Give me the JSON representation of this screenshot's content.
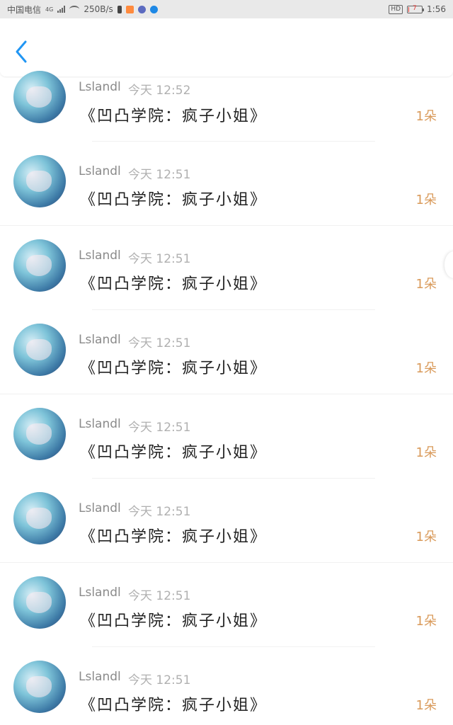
{
  "status_bar": {
    "carrier": "中国电信",
    "network_type": "4G",
    "net_speed": "250B/s",
    "hd_label": "HD",
    "battery_level": "7",
    "battery_percent": 0.07,
    "time": "1:56"
  },
  "header": {
    "back_icon": "chevron-left-icon",
    "accent_color": "#2196f3"
  },
  "colors": {
    "count_color": "#d99a5a",
    "name_color": "#8a8a8a"
  },
  "messages": [
    {
      "user": "Lslandl",
      "time": "今天 12:52",
      "title": "《凹凸学院：疯子小姐》",
      "count": "1朵"
    },
    {
      "user": "Lslandl",
      "time": "今天 12:51",
      "title": "《凹凸学院：疯子小姐》",
      "count": "1朵"
    },
    {
      "user": "Lslandl",
      "time": "今天 12:51",
      "title": "《凹凸学院：疯子小姐》",
      "count": "1朵"
    },
    {
      "user": "Lslandl",
      "time": "今天 12:51",
      "title": "《凹凸学院：疯子小姐》",
      "count": "1朵"
    },
    {
      "user": "Lslandl",
      "time": "今天 12:51",
      "title": "《凹凸学院：疯子小姐》",
      "count": "1朵"
    },
    {
      "user": "Lslandl",
      "time": "今天 12:51",
      "title": "《凹凸学院：疯子小姐》",
      "count": "1朵"
    },
    {
      "user": "Lslandl",
      "time": "今天 12:51",
      "title": "《凹凸学院：疯子小姐》",
      "count": "1朵"
    },
    {
      "user": "Lslandl",
      "time": "今天 12:51",
      "title": "《凹凸学院：疯子小姐》",
      "count": "1朵"
    }
  ]
}
